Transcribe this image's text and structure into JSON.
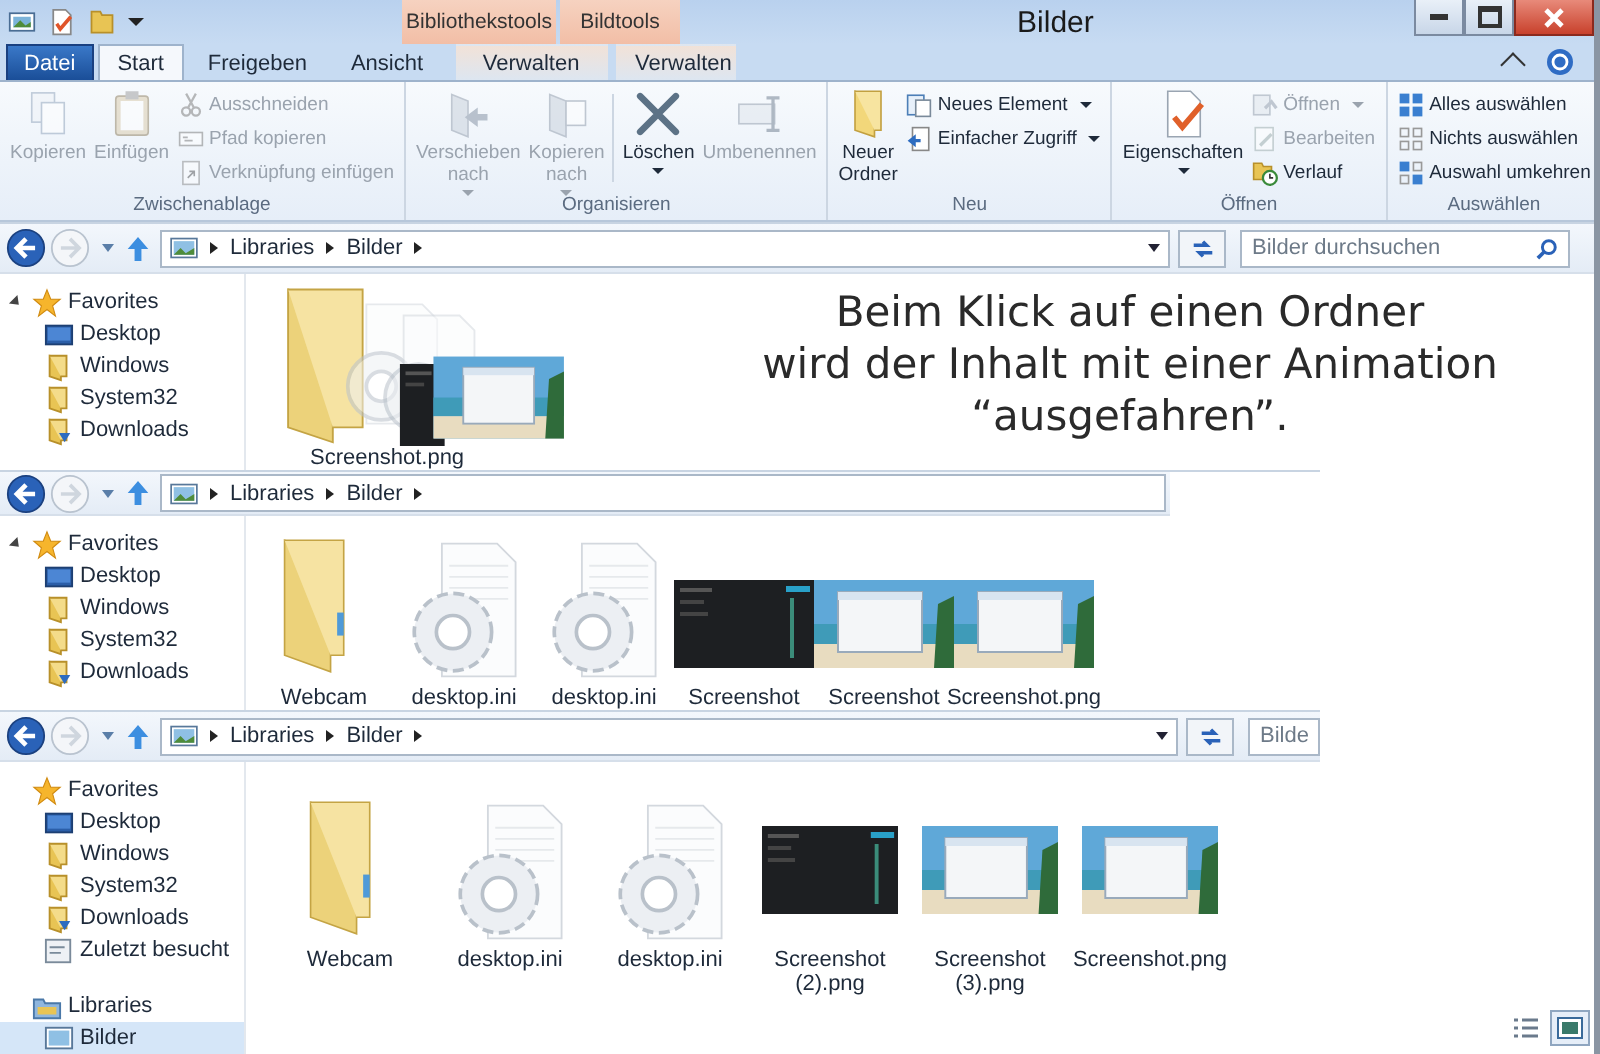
{
  "window": {
    "title": "Bilder"
  },
  "context_groups": [
    {
      "header": "Bibliothekstools",
      "tab": {
        "label": "Verwalten",
        "selected": false
      }
    },
    {
      "header": "Bildtools",
      "tab": {
        "label": "Verwalten",
        "selected": false
      }
    }
  ],
  "tabs": [
    {
      "label": "Datei",
      "kind": "file",
      "selected": false
    },
    {
      "label": "Start",
      "kind": "tab",
      "selected": true
    },
    {
      "label": "Freigeben",
      "kind": "tab",
      "selected": false
    },
    {
      "label": "Ansicht",
      "kind": "tab",
      "selected": false
    }
  ],
  "ribbon": {
    "groups": [
      {
        "label": "Zwischenablage",
        "large": [
          {
            "label": "Kopieren",
            "disabled": true,
            "dropdown": false
          },
          {
            "label": "Einfügen",
            "disabled": true,
            "dropdown": false
          }
        ],
        "small": [
          {
            "label": "Ausschneiden",
            "disabled": true,
            "dropdown": false
          },
          {
            "label": "Pfad kopieren",
            "disabled": true,
            "dropdown": false
          },
          {
            "label": "Verknüpfung einfügen",
            "disabled": true,
            "dropdown": false
          }
        ]
      },
      {
        "label": "Organisieren",
        "large": [
          {
            "label": "Verschieben nach",
            "disabled": true,
            "dropdown": true,
            "separator_before": false
          },
          {
            "label": "Kopieren nach",
            "disabled": true,
            "dropdown": true,
            "separator_before": false
          },
          {
            "label": "Löschen",
            "disabled": false,
            "dropdown": true,
            "separator_before": true
          },
          {
            "label": "Umbenennen",
            "disabled": true,
            "dropdown": false,
            "separator_before": false
          }
        ]
      },
      {
        "label": "Neu",
        "large": [
          {
            "label": "Neuer Ordner",
            "disabled": false,
            "dropdown": false
          }
        ],
        "small": [
          {
            "label": "Neues Element",
            "disabled": false,
            "dropdown": true
          },
          {
            "label": "Einfacher Zugriff",
            "disabled": false,
            "dropdown": true
          }
        ]
      },
      {
        "label": "Öffnen",
        "large": [
          {
            "label": "Eigenschaften",
            "disabled": false,
            "dropdown": true
          }
        ],
        "small": [
          {
            "label": "Öffnen",
            "disabled": true,
            "dropdown": true
          },
          {
            "label": "Bearbeiten",
            "disabled": true,
            "dropdown": false
          },
          {
            "label": "Verlauf",
            "disabled": false,
            "dropdown": false
          }
        ]
      },
      {
        "label": "Auswählen",
        "small": [
          {
            "label": "Alles auswählen",
            "disabled": false,
            "dropdown": false
          },
          {
            "label": "Nichts auswählen",
            "disabled": false,
            "dropdown": false
          },
          {
            "label": "Auswahl umkehren",
            "disabled": false,
            "dropdown": false
          }
        ]
      }
    ]
  },
  "panes": [
    {
      "address": [
        "Libraries",
        "Bilder"
      ],
      "address_dropdown": true,
      "search": {
        "placeholder": "Bilder durchsuchen"
      },
      "tree": [
        {
          "label": "Favorites",
          "kind": "star",
          "expanded": true,
          "children": [
            {
              "label": "Desktop",
              "kind": "desktop"
            },
            {
              "label": "Windows",
              "kind": "folder"
            },
            {
              "label": "System32",
              "kind": "folder"
            },
            {
              "label": "Downloads",
              "kind": "downloads"
            }
          ]
        }
      ],
      "stack": {
        "label": "Screenshot.png",
        "items": [
          {
            "kind": "folder"
          },
          {
            "kind": "settings"
          },
          {
            "kind": "settings"
          },
          {
            "kind": "dark"
          },
          {
            "kind": "beach"
          }
        ]
      },
      "caption": "Beim Klick auf einen Ordner\nwird der Inhalt mit einer Animation\n“ausgefahren”."
    },
    {
      "address": [
        "Libraries",
        "Bilder"
      ],
      "address_dropdown": false,
      "tree": [
        {
          "label": "Favorites",
          "kind": "star",
          "expanded": true,
          "children": [
            {
              "label": "Desktop",
              "kind": "desktop"
            },
            {
              "label": "Windows",
              "kind": "folder"
            },
            {
              "label": "System32",
              "kind": "folder"
            },
            {
              "label": "Downloads",
              "kind": "downloads"
            }
          ]
        }
      ],
      "files": [
        {
          "label": "Webcam",
          "kind": "folder"
        },
        {
          "label": "desktop.ini",
          "kind": "settings"
        },
        {
          "label": "desktop.ini",
          "kind": "settings"
        },
        {
          "label": "Screenshot",
          "kind": "dark"
        },
        {
          "label": "Screenshot",
          "kind": "beach"
        },
        {
          "label": "Screenshot.png",
          "kind": "beach"
        }
      ]
    },
    {
      "address": [
        "Libraries",
        "Bilder"
      ],
      "address_dropdown": true,
      "search": {
        "placeholder": "Bilde"
      },
      "tree": [
        {
          "label": "Favorites",
          "kind": "star",
          "children": [
            {
              "label": "Desktop",
              "kind": "desktop"
            },
            {
              "label": "Windows",
              "kind": "folder"
            },
            {
              "label": "System32",
              "kind": "folder"
            },
            {
              "label": "Downloads",
              "kind": "downloads"
            },
            {
              "label": "Zuletzt besucht",
              "kind": "recent"
            }
          ]
        },
        {
          "label": "Libraries",
          "kind": "library",
          "children": [
            {
              "label": "Bilder",
              "kind": "pictures",
              "selected": true
            }
          ]
        }
      ],
      "files": [
        {
          "label": "Webcam",
          "kind": "folder"
        },
        {
          "label": "desktop.ini",
          "kind": "settings"
        },
        {
          "label": "desktop.ini",
          "kind": "settings"
        },
        {
          "label": "Screenshot (2).png",
          "kind": "dark"
        },
        {
          "label": "Screenshot (3).png",
          "kind": "beach"
        },
        {
          "label": "Screenshot.png",
          "kind": "beach"
        }
      ]
    }
  ],
  "view_buttons": [
    {
      "kind": "details",
      "selected": false
    },
    {
      "kind": "thumbnails",
      "selected": true
    }
  ]
}
